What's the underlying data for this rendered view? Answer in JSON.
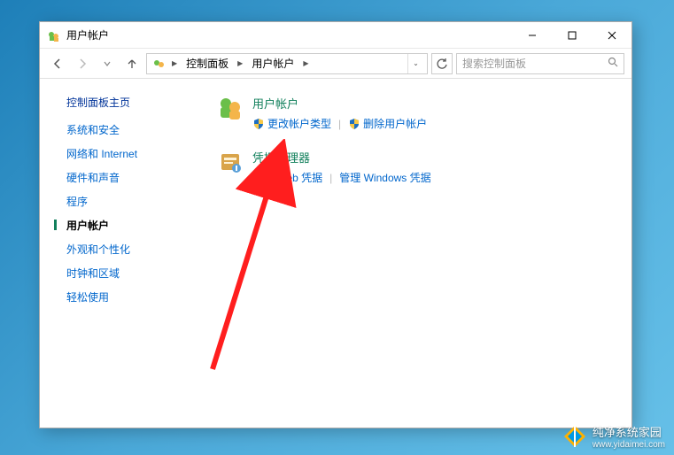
{
  "window": {
    "title": "用户帐户"
  },
  "nav": {
    "crumbs": [
      "控制面板",
      "用户帐户"
    ],
    "search_placeholder": "搜索控制面板"
  },
  "sidebar": {
    "title": "控制面板主页",
    "items": [
      {
        "label": "系统和安全",
        "current": false
      },
      {
        "label": "网络和 Internet",
        "current": false
      },
      {
        "label": "硬件和声音",
        "current": false
      },
      {
        "label": "程序",
        "current": false
      },
      {
        "label": "用户帐户",
        "current": true
      },
      {
        "label": "外观和个性化",
        "current": false
      },
      {
        "label": "时钟和区域",
        "current": false
      },
      {
        "label": "轻松使用",
        "current": false
      }
    ]
  },
  "main": {
    "categories": [
      {
        "icon": "user-accounts-icon",
        "title": "用户帐户",
        "links": [
          {
            "shield": true,
            "label": "更改帐户类型"
          },
          {
            "shield": true,
            "label": "删除用户帐户"
          }
        ]
      },
      {
        "icon": "credential-manager-icon",
        "title": "凭据管理器",
        "links": [
          {
            "shield": false,
            "label": "管理 Web 凭据"
          },
          {
            "shield": false,
            "label": "管理 Windows 凭据"
          }
        ]
      }
    ]
  },
  "watermark": {
    "title": "纯净系统家园",
    "url": "www.yidaimei.com"
  },
  "colors": {
    "link": "#0066cc",
    "heading": "#12805c",
    "accent_red": "#ff1e1e"
  }
}
